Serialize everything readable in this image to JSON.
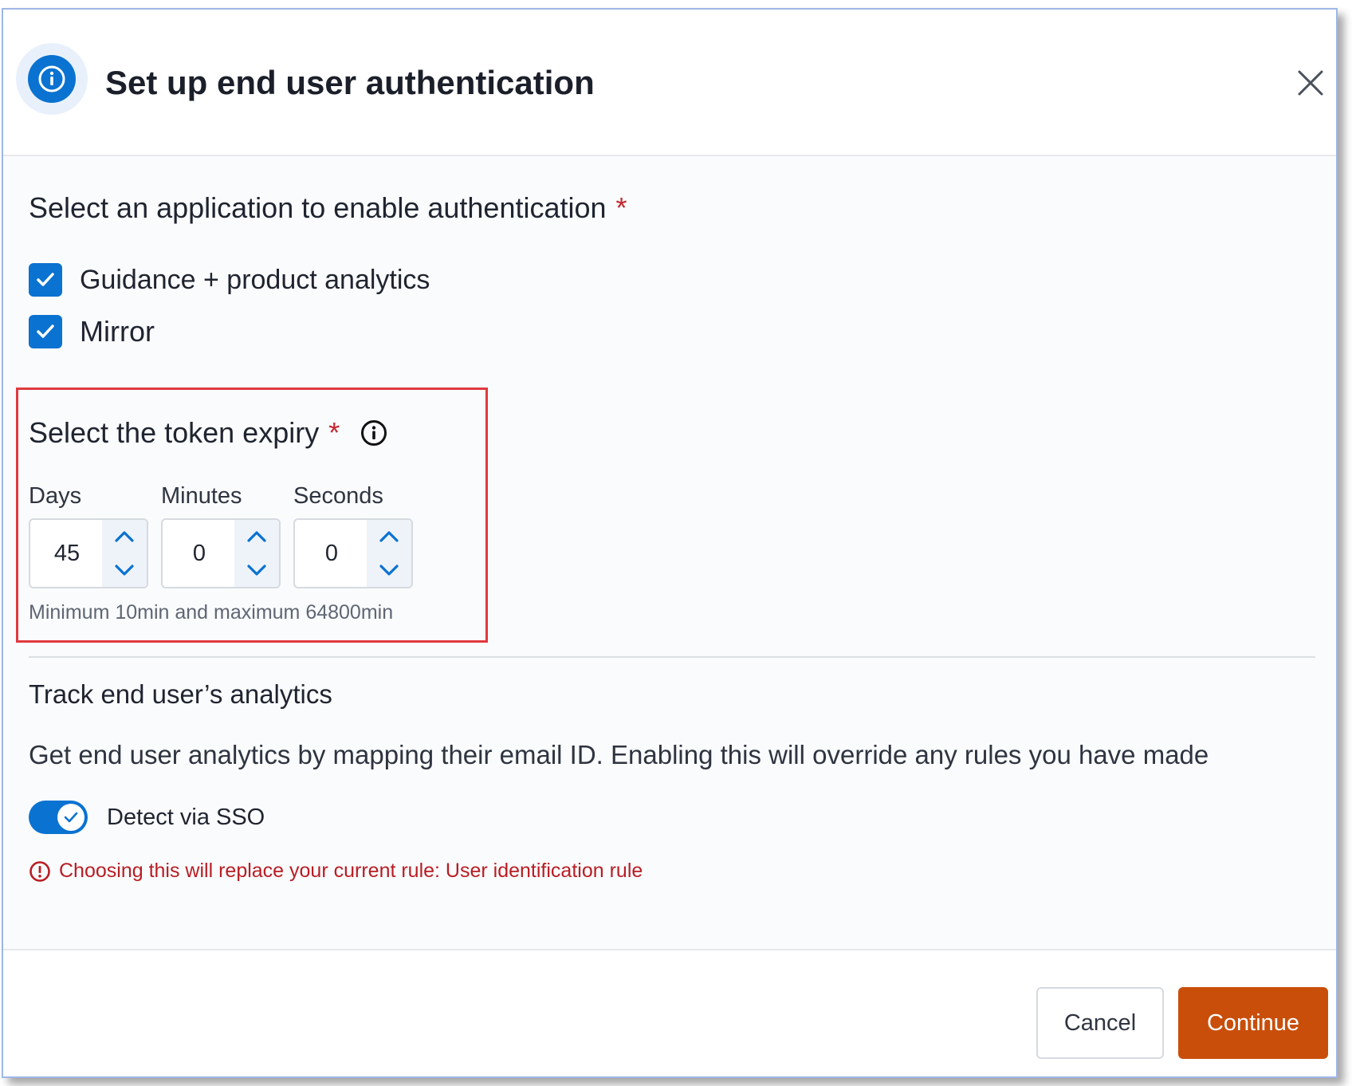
{
  "dialog": {
    "title": "Set up end user authentication",
    "header_icon": "info-circle-icon",
    "close_icon": "close-icon"
  },
  "application_section": {
    "label": "Select an application to enable authentication",
    "required_marker": "*",
    "options": [
      {
        "label": "Guidance + product analytics",
        "checked": true
      },
      {
        "label": "Mirror",
        "checked": true
      }
    ]
  },
  "token_expiry": {
    "label": "Select the token expiry",
    "required_marker": "*",
    "info_icon": "info-icon",
    "fields": [
      {
        "label": "Days",
        "value": "45"
      },
      {
        "label": "Minutes",
        "value": "0"
      },
      {
        "label": "Seconds",
        "value": "0"
      }
    ],
    "hint": "Minimum 10min and maximum 64800min"
  },
  "analytics": {
    "title": "Track end user’s analytics",
    "description": "Get end user analytics by mapping their email ID. Enabling this will override any rules you have made",
    "toggle_label": "Detect via SSO",
    "toggle_on": true,
    "warning": "Choosing this will replace your current rule: User identification rule",
    "warning_icon": "alert-circle-icon"
  },
  "footer": {
    "cancel_label": "Cancel",
    "continue_label": "Continue"
  },
  "colors": {
    "accent": "#0a72d1",
    "primary_button": "#c94e0a",
    "required": "#c4262e",
    "warning": "#b81d24",
    "highlight": "#e0393e"
  }
}
